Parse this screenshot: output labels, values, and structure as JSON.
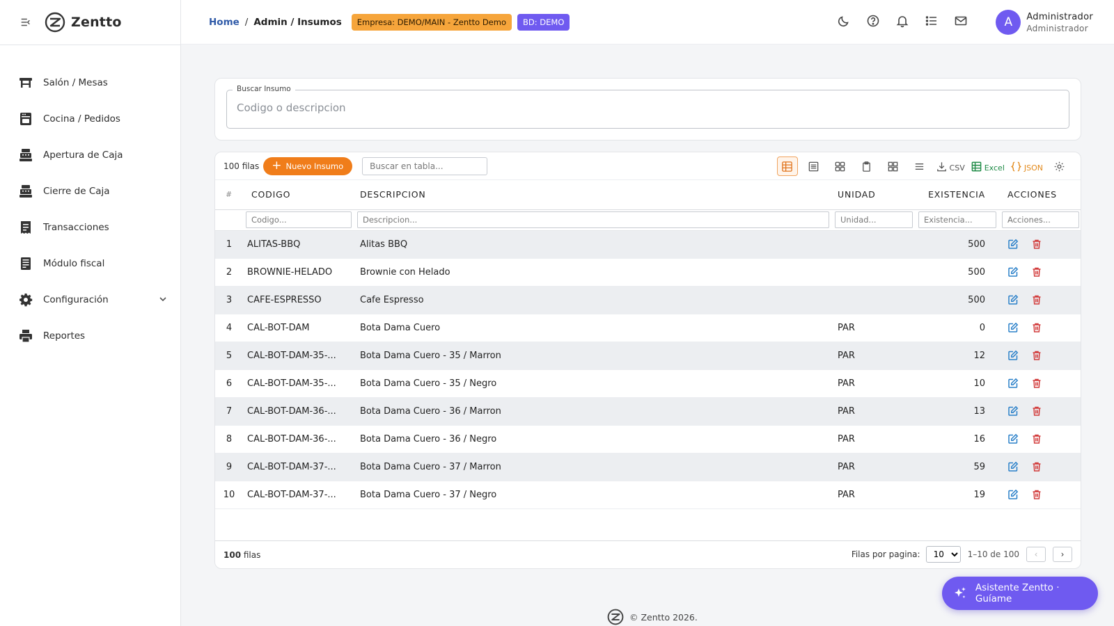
{
  "app": {
    "name": "Zentto"
  },
  "sidebar": {
    "items": [
      {
        "label": "Salón / Mesas",
        "icon": "table-icon"
      },
      {
        "label": "Cocina / Pedidos",
        "icon": "kitchen-icon"
      },
      {
        "label": "Apertura de Caja",
        "icon": "cash-register-icon"
      },
      {
        "label": "Cierre de Caja",
        "icon": "cash-register-icon"
      },
      {
        "label": "Transacciones",
        "icon": "receipt-icon"
      },
      {
        "label": "Módulo fiscal",
        "icon": "fiscal-receipt-icon"
      },
      {
        "label": "Configuración",
        "icon": "gear-icon"
      },
      {
        "label": "Reportes",
        "icon": "printer-icon"
      }
    ]
  },
  "header": {
    "breadcrumb_home": "Home",
    "breadcrumb_sep": "/",
    "breadcrumb_current": "Admin / Insumos",
    "badge_empresa": "Empresa: DEMO/MAIN - Zentto Demo",
    "badge_bd": "BD: DEMO",
    "user_initial": "A",
    "user_name": "Administrador",
    "user_role": "Administrador"
  },
  "search": {
    "legend": "Buscar Insumo",
    "placeholder": "Codigo o descripcion"
  },
  "toolbar": {
    "row_count": "100 filas",
    "new_button": "Nuevo Insumo",
    "table_search_placeholder": "Buscar en tabla...",
    "csv": "CSV",
    "excel": "Excel",
    "json": "JSON"
  },
  "table": {
    "columns": [
      "#",
      "CODIGO",
      "DESCRIPCION",
      "UNIDAD",
      "EXISTENCIA",
      "ACCIONES"
    ],
    "filters": [
      "Codigo...",
      "Descripcion...",
      "Unidad...",
      "Existencia...",
      "Acciones..."
    ],
    "rows": [
      {
        "idx": "1",
        "code": "ALITAS-BBQ",
        "desc": "Alitas BBQ",
        "unit": "",
        "stock": "500"
      },
      {
        "idx": "2",
        "code": "BROWNIE-HELADO",
        "desc": "Brownie con Helado",
        "unit": "",
        "stock": "500"
      },
      {
        "idx": "3",
        "code": "CAFE-ESPRESSO",
        "desc": "Cafe Espresso",
        "unit": "",
        "stock": "500"
      },
      {
        "idx": "4",
        "code": "CAL-BOT-DAM",
        "desc": "Bota Dama Cuero",
        "unit": "PAR",
        "stock": "0"
      },
      {
        "idx": "5",
        "code": "CAL-BOT-DAM-35-...",
        "desc": "Bota Dama Cuero - 35 / Marron",
        "unit": "PAR",
        "stock": "12"
      },
      {
        "idx": "6",
        "code": "CAL-BOT-DAM-35-...",
        "desc": "Bota Dama Cuero - 35 / Negro",
        "unit": "PAR",
        "stock": "10"
      },
      {
        "idx": "7",
        "code": "CAL-BOT-DAM-36-...",
        "desc": "Bota Dama Cuero - 36 / Marron",
        "unit": "PAR",
        "stock": "13"
      },
      {
        "idx": "8",
        "code": "CAL-BOT-DAM-36-...",
        "desc": "Bota Dama Cuero - 36 / Negro",
        "unit": "PAR",
        "stock": "16"
      },
      {
        "idx": "9",
        "code": "CAL-BOT-DAM-37-...",
        "desc": "Bota Dama Cuero - 37 / Marron",
        "unit": "PAR",
        "stock": "59"
      },
      {
        "idx": "10",
        "code": "CAL-BOT-DAM-37-...",
        "desc": "Bota Dama Cuero - 37 / Negro",
        "unit": "PAR",
        "stock": "19"
      }
    ]
  },
  "footer_bar": {
    "count_bold": "100",
    "count_rest": " filas",
    "per_page_label": "Filas por pagina:",
    "per_page_value": "10",
    "range": "1–10 de 100",
    "prev": "‹",
    "next": "›"
  },
  "assistant": {
    "label": "Asistente Zentto · Guíame"
  },
  "copyright": "© Zentto 2026.",
  "colors": {
    "primary": "#6f5af0",
    "accent_orange": "#f07d1a",
    "badge_empresa": "#f6a53b",
    "edit": "#2a80c9",
    "delete": "#d23b3b",
    "link": "#2f5aa8"
  }
}
